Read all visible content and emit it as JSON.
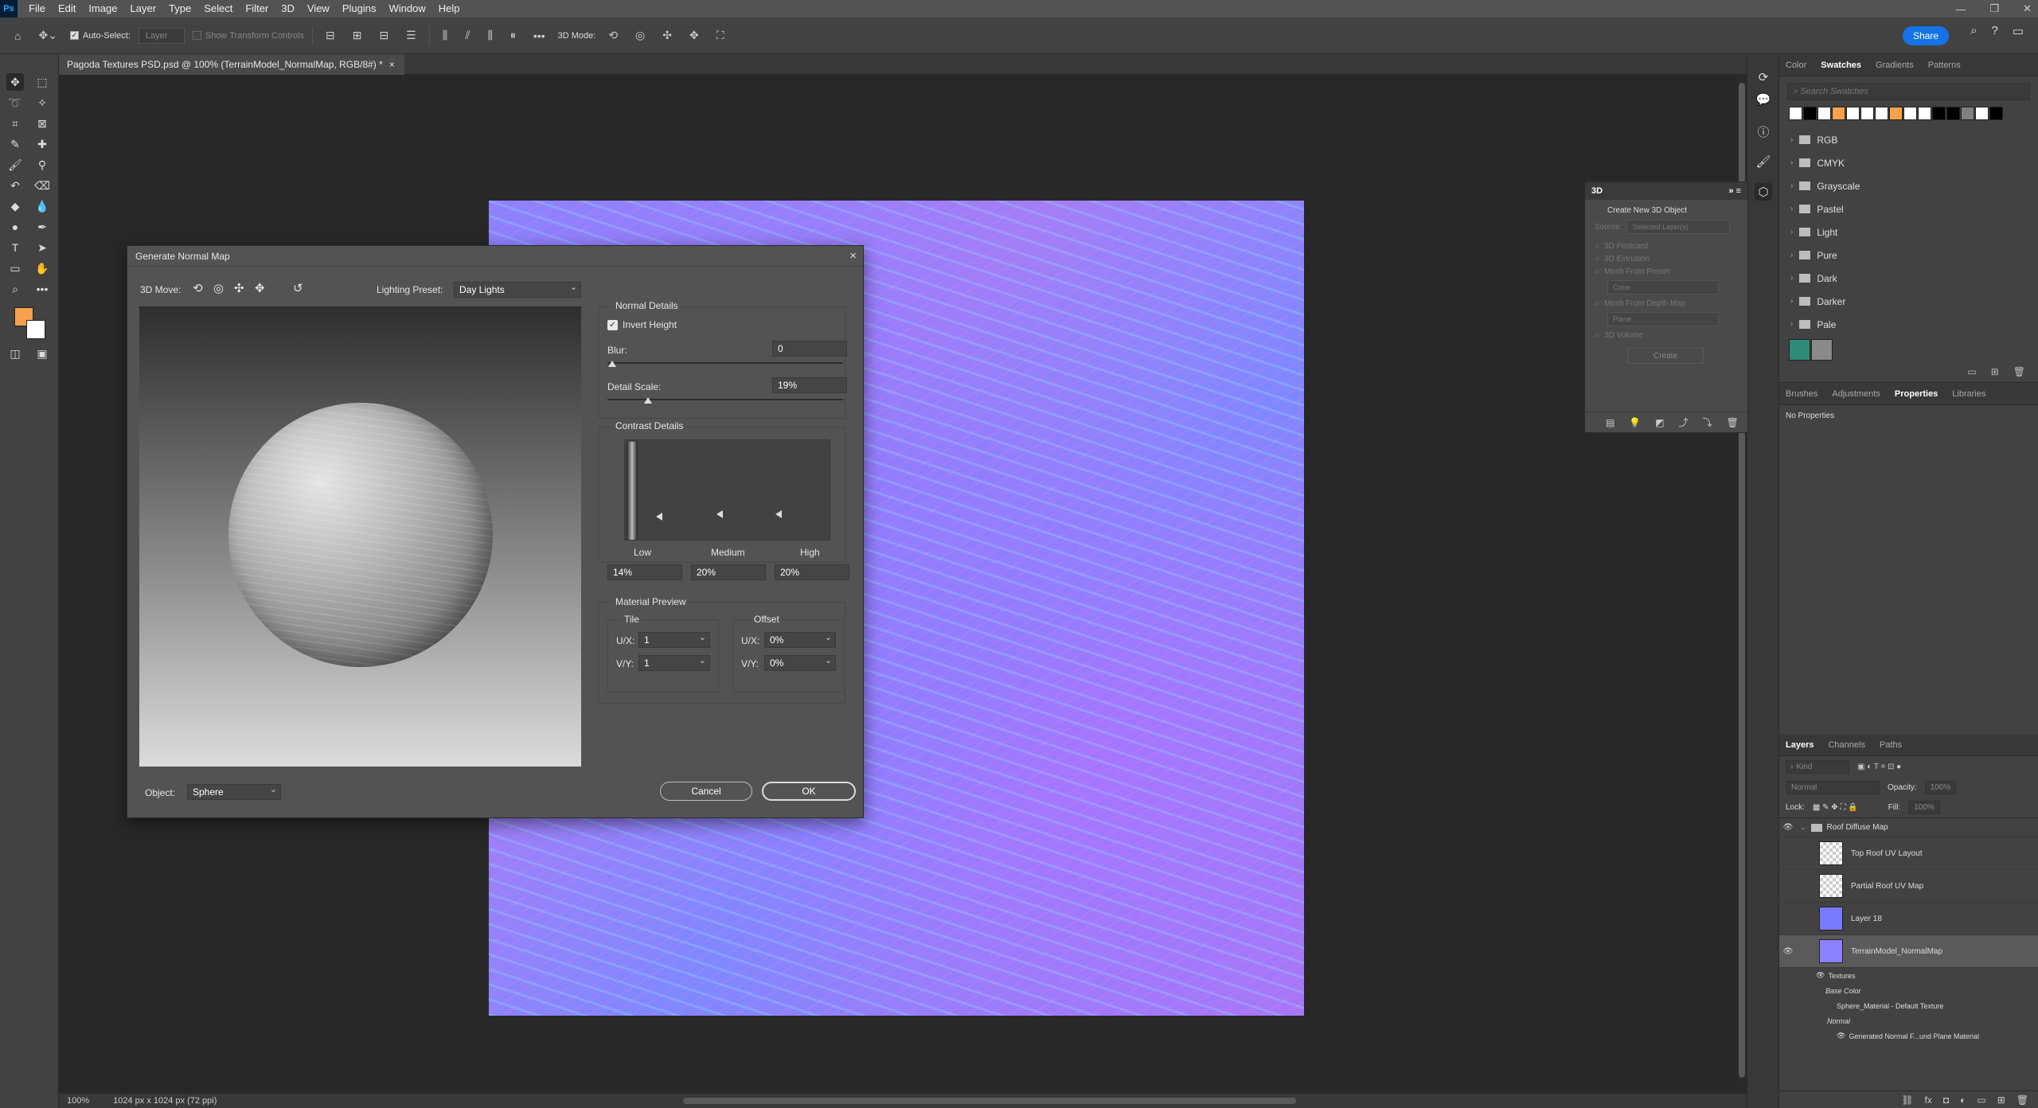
{
  "app": {
    "logo": "Ps"
  },
  "menu": [
    "File",
    "Edit",
    "Image",
    "Layer",
    "Type",
    "Select",
    "Filter",
    "3D",
    "View",
    "Plugins",
    "Window",
    "Help"
  ],
  "options": {
    "auto_select_label": "Auto-Select:",
    "auto_select_value": "Layer",
    "transform_label": "Show Transform Controls",
    "mode_3d_label": "3D Mode:",
    "share_label": "Share"
  },
  "document": {
    "tab_title": "Pagoda Textures PSD.psd @ 100% (TerrainModel_NormalMap, RGB/8#) *",
    "zoom": "100%",
    "doc_info": "1024 px x 1024 px (72 ppi)"
  },
  "panel3d": {
    "title": "3D",
    "heading": "Create New 3D Object",
    "source_label": "Source:",
    "source_value": "Selected Layer(s)",
    "options": [
      "3D Postcard",
      "3D Extrusion",
      "Mesh From Preset",
      "Mesh From Depth Map",
      "3D Volume"
    ],
    "preset_value": "Cone",
    "depth_value": "Plane",
    "create_label": "Create"
  },
  "swatches_panel": {
    "tabs": [
      "Color",
      "Swatches",
      "Gradients",
      "Patterns"
    ],
    "active_tab": "Swatches",
    "search_placeholder": "Search Swatches",
    "recent": [
      "#ffffff",
      "#000000",
      "#ffffff",
      "#f7a14d",
      "#ffffff",
      "#ffffff",
      "#ffffff",
      "#f7a14d",
      "#ffffff",
      "#ffffff",
      "#000000",
      "#000000",
      "#808080",
      "#ffffff",
      "#000000"
    ],
    "folders": [
      "RGB",
      "CMYK",
      "Grayscale",
      "Pastel",
      "Light",
      "Pure",
      "Dark",
      "Darker",
      "Pale"
    ],
    "bottom_swatches": [
      "#2e8b78",
      "#8a8a8a"
    ]
  },
  "properties_panel": {
    "tabs": [
      "Brushes",
      "Adjustments",
      "Properties",
      "Libraries"
    ],
    "active_tab": "Properties",
    "content": "No Properties"
  },
  "layers_panel": {
    "tabs": [
      "Layers",
      "Channels",
      "Paths"
    ],
    "active_tab": "Layers",
    "kind_placeholder": "Kind",
    "blend_mode": "Normal",
    "opacity_label": "Opacity:",
    "opacity_value": "100%",
    "lock_label": "Lock:",
    "fill_label": "Fill:",
    "fill_value": "100%",
    "group_name": "Roof Diffuse Map",
    "layers": [
      {
        "name": "Top Roof UV Layout",
        "visible": false
      },
      {
        "name": "Partial Roof UV Map",
        "visible": false
      },
      {
        "name": "Layer 18",
        "visible": false
      },
      {
        "name": "TerrainModel_NormalMap",
        "visible": true
      }
    ],
    "sub_items": [
      "Textures",
      "Base Color",
      "Sphere_Material - Default Texture",
      "Normal",
      "Generated Normal F...und Plane Material"
    ]
  },
  "dialog": {
    "title": "Generate Normal Map",
    "move_label": "3D Move:",
    "lighting_label": "Lighting Preset:",
    "lighting_value": "Day Lights",
    "normal_details_title": "Normal Details",
    "invert_height_label": "Invert Height",
    "invert_height_checked": true,
    "blur_label": "Blur:",
    "blur_value": "0",
    "detail_scale_label": "Detail Scale:",
    "detail_scale_value": "19%",
    "contrast_title": "Contrast Details",
    "contrast_labels": [
      "Low",
      "Medium",
      "High"
    ],
    "contrast_values": [
      "14%",
      "20%",
      "20%"
    ],
    "material_title": "Material Preview",
    "tile_title": "Tile",
    "offset_title": "Offset",
    "ux_label": "U/X:",
    "vy_label": "V/Y:",
    "tile_ux": "1",
    "tile_vy": "1",
    "offset_ux": "0%",
    "offset_vy": "0%",
    "object_label": "Object:",
    "object_value": "Sphere",
    "cancel_label": "Cancel",
    "ok_label": "OK"
  }
}
